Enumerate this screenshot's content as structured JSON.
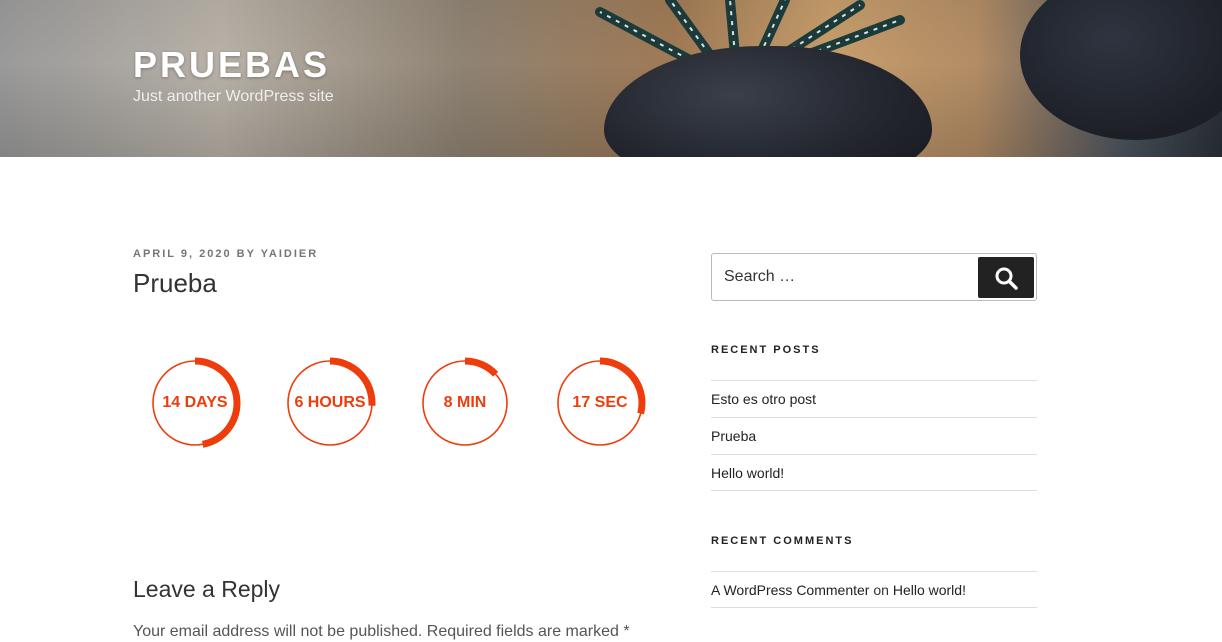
{
  "site": {
    "title": "PRUEBAS",
    "description": "Just another WordPress site"
  },
  "post": {
    "date": "APRIL 9, 2020",
    "by": "BY",
    "author": "YAIDIER",
    "title": "Prueba",
    "countdown": [
      {
        "label": "14 DAYS",
        "fraction": 0.47
      },
      {
        "label": "6 HOURS",
        "fraction": 0.26
      },
      {
        "label": "8 MIN",
        "fraction": 0.13
      },
      {
        "label": "17 SEC",
        "fraction": 0.29
      }
    ],
    "accent_color": "#ee3d0c"
  },
  "reply": {
    "title": "Leave a Reply",
    "note": "Your email address will not be published. Required fields are marked *"
  },
  "sidebar": {
    "search": {
      "placeholder": "Search …",
      "icon": "search-icon"
    },
    "recent_posts": {
      "title": "RECENT POSTS",
      "items": [
        "Esto es otro post",
        "Prueba",
        "Hello world!"
      ]
    },
    "recent_comments": {
      "title": "RECENT COMMENTS",
      "items": [
        {
          "author": "A WordPress Commenter",
          "on": "on",
          "post": "Hello world!"
        }
      ]
    }
  }
}
